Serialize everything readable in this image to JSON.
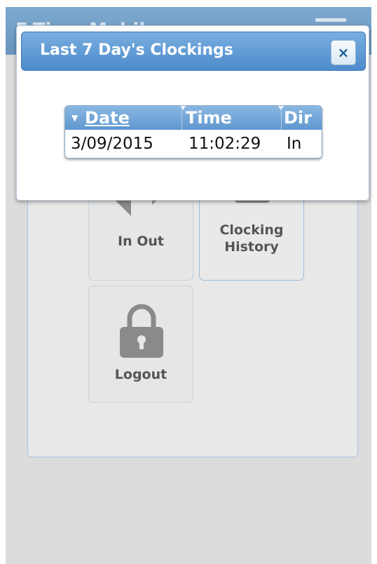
{
  "app": {
    "header_title": "E-Time Mobile",
    "tiles": [
      {
        "label": "In Out"
      },
      {
        "label_line1": "Clocking",
        "label_line2": "History"
      },
      {
        "label": "Logout"
      }
    ]
  },
  "dialog": {
    "title": "Last 7 Day's Clockings",
    "close_label": "×",
    "table": {
      "columns": [
        "Date",
        "Time",
        "Dir"
      ],
      "sorted_column": "Date",
      "rows": [
        {
          "date": "3/09/2015",
          "time": "11:02:29",
          "dir": "In"
        }
      ]
    }
  },
  "colors": {
    "titlebar": "#4d8bcb",
    "icon_gray": "#8a8a8a"
  }
}
